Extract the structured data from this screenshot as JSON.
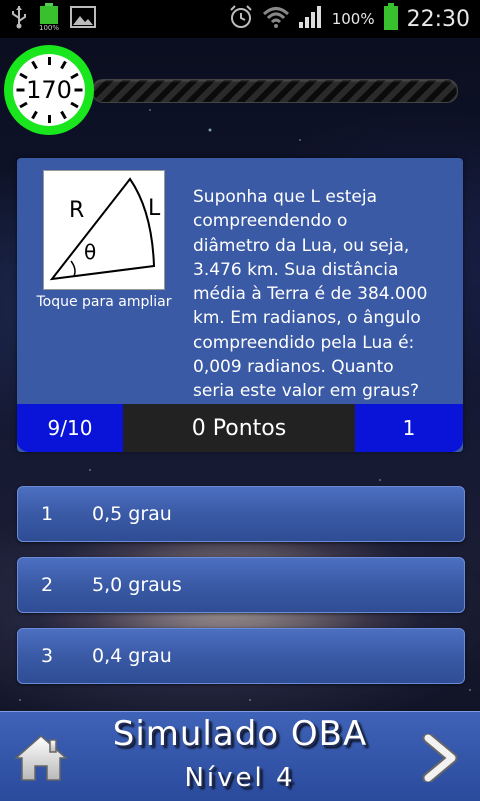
{
  "status_bar": {
    "battery_percent": "100%",
    "time": "22:30",
    "left_icons": [
      "usb-icon",
      "battery-small-icon",
      "image-icon"
    ],
    "right_icons": [
      "alarm-icon",
      "wifi-icon",
      "signal-icon",
      "battery-icon"
    ]
  },
  "timer": {
    "value": "170",
    "progress_fraction": 0.0,
    "ring_color": "#19e61c"
  },
  "question": {
    "image_caption": "Toque para ampliar",
    "diagram_labels": {
      "r": "R",
      "l": "L",
      "theta": "θ"
    },
    "text": "Suponha que L esteja\ncompreendendo o\ndiâmetro da Lua, ou seja,\n3.476 km. Sua distância\nmédia à Terra é de 384.000\nkm. Em radianos, o ângulo\ncompreendido pela Lua é:\n0,009 radianos. Quanto\nseria este valor em graus?",
    "counter": "9/10",
    "points": "0 Pontos",
    "score_right": "1"
  },
  "answers": [
    {
      "number": "1",
      "label": "0,5 grau"
    },
    {
      "number": "2",
      "label": "5,0 graus"
    },
    {
      "number": "3",
      "label": "0,4 grau"
    }
  ],
  "footer": {
    "title": "Simulado OBA",
    "subtitle": "Nível 4",
    "home_icon": "home-icon",
    "next_icon": "chevron-right-icon"
  },
  "colors": {
    "panel": "#3a5aa6",
    "footer_blue": "#0a14d8",
    "footer_dark": "#222222",
    "accent_green": "#19e61c"
  }
}
